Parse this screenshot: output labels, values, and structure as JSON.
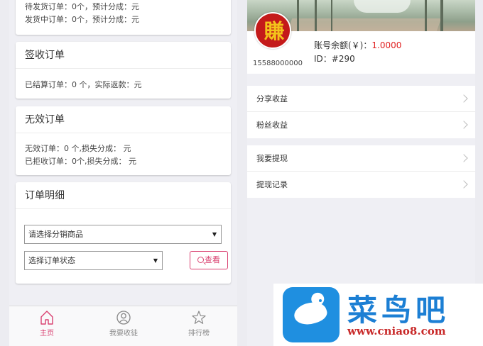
{
  "left": {
    "pending": {
      "line1": "待发货订单：0个，预计分成：元",
      "line2": "发货中订单：0个，预计分成：元"
    },
    "signed": {
      "title": "签收订单",
      "line1": "已结算订单：0 个，实际返款：元"
    },
    "invalid": {
      "title": "无效订单",
      "line1": "无效订单：0 个,损失分成：  元",
      "line2": "已拒收订单：0个,损失分成：  元"
    },
    "detail": {
      "title": "订单明细",
      "product_select": "请选择分销商品",
      "status_select": "选择订单状态",
      "view_button": "查看"
    },
    "tabbar": {
      "items": [
        {
          "label": "主页",
          "icon": "home-icon",
          "active": true
        },
        {
          "label": "我要收徒",
          "icon": "user-circle-icon",
          "active": false
        },
        {
          "label": "排行榜",
          "icon": "star-icon",
          "active": false
        }
      ]
    }
  },
  "right": {
    "profile": {
      "phone": "15588000000",
      "balance_label": "账号余额(￥)：",
      "balance_value": "1.0000",
      "id_text": "ID：#290"
    },
    "menu_group1": [
      "分享收益",
      "粉丝收益"
    ],
    "menu_group2": [
      "我要提现",
      "提现记录"
    ]
  },
  "watermark": {
    "brand": "菜鸟吧",
    "url": "www.cniao8.com"
  },
  "colors": {
    "accent": "#d94070",
    "balance": "#e02020",
    "logo_blue": "#1f8fe0",
    "logo_red": "#c82828"
  }
}
